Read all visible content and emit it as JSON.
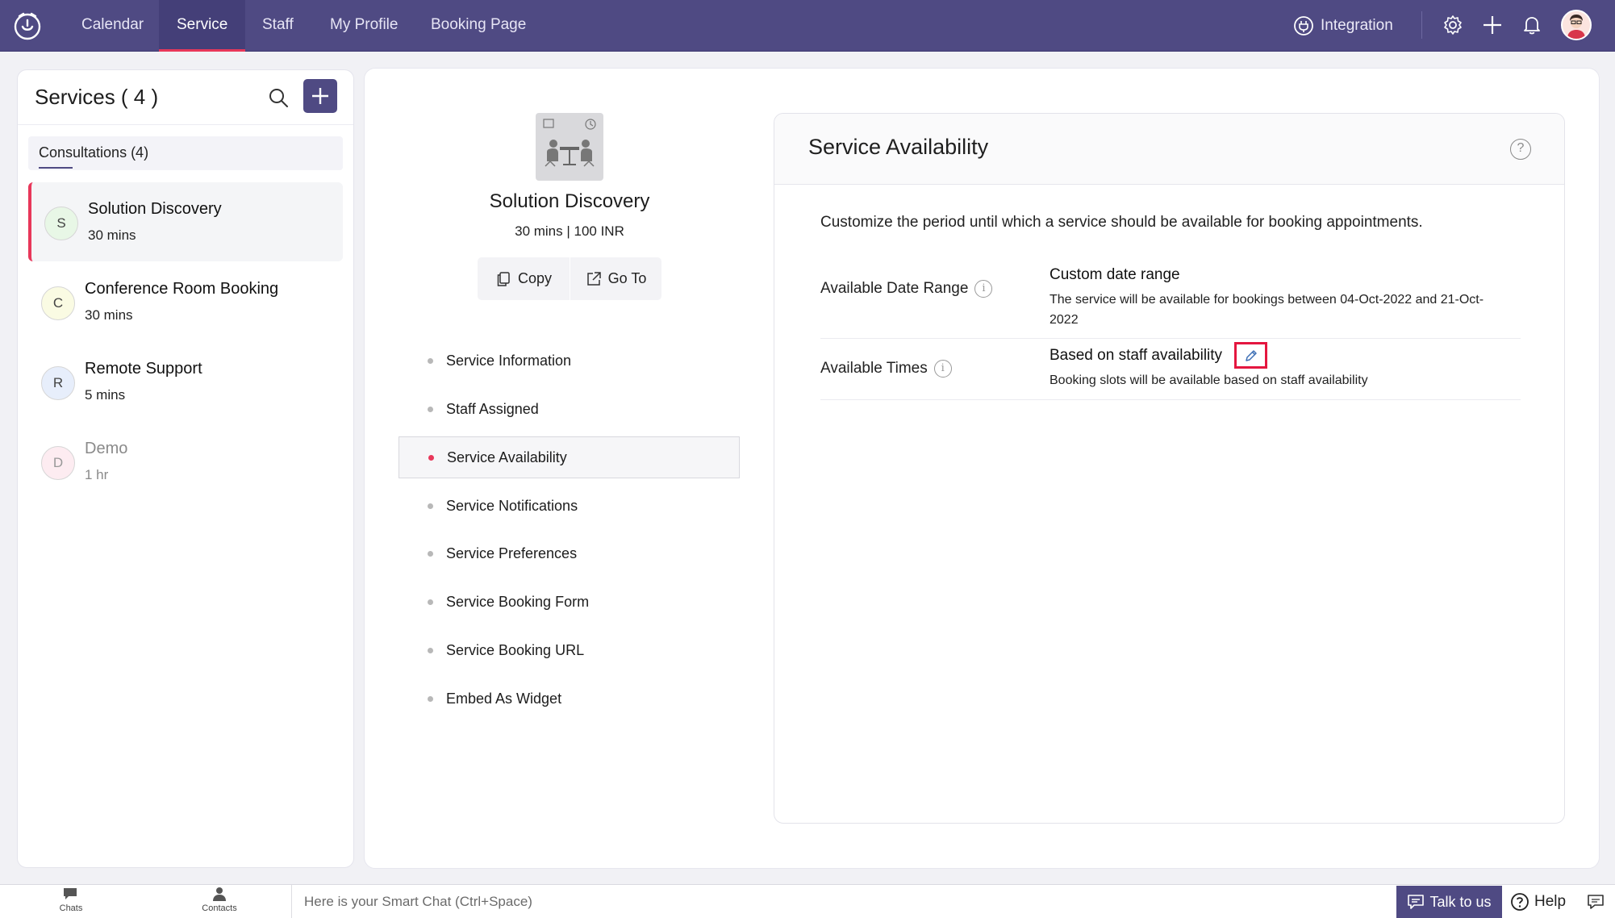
{
  "nav": {
    "tabs": [
      {
        "label": "Calendar"
      },
      {
        "label": "Service"
      },
      {
        "label": "Staff"
      },
      {
        "label": "My Profile"
      },
      {
        "label": "Booking Page"
      }
    ],
    "active_tab": "Service",
    "integration_label": "Integration"
  },
  "services_panel": {
    "title": "Services ( 4 )",
    "category_tab": "Consultations (4)",
    "items": [
      {
        "initial": "S",
        "name": "Solution Discovery",
        "duration": "30 mins",
        "selected": true,
        "color": "#e8f7e6"
      },
      {
        "initial": "C",
        "name": "Conference Room Booking",
        "duration": "30 mins",
        "selected": false,
        "color": "#fafbe3"
      },
      {
        "initial": "R",
        "name": "Remote Support",
        "duration": "5 mins",
        "selected": false,
        "color": "#e7eefb"
      },
      {
        "initial": "D",
        "name": "Demo",
        "duration": "1 hr",
        "selected": false,
        "color": "#fdecf1"
      }
    ]
  },
  "service_detail": {
    "name": "Solution Discovery",
    "subtitle": "30 mins | 100 INR",
    "copy_label": "Copy",
    "goto_label": "Go To",
    "menu": [
      {
        "label": "Service Information"
      },
      {
        "label": "Staff Assigned"
      },
      {
        "label": "Service Availability"
      },
      {
        "label": "Service Notifications"
      },
      {
        "label": "Service Preferences"
      },
      {
        "label": "Service Booking Form"
      },
      {
        "label": "Service Booking URL"
      },
      {
        "label": "Embed As Widget"
      }
    ],
    "active_menu": "Service Availability"
  },
  "availability": {
    "title": "Service Availability",
    "description": "Customize the period until which a service should be available for booking appointments.",
    "date_range": {
      "label": "Available Date Range",
      "value": "Custom date range",
      "desc_prefix": "The service will be available for bookings between ",
      "start": "04-Oct-2022",
      "mid": " and ",
      "end": "21-Oct-2022"
    },
    "times": {
      "label": "Available Times",
      "value": "Based on staff availability",
      "desc": "Booking slots will be available based on staff availability"
    }
  },
  "bottom_bar": {
    "chats": "Chats",
    "contacts": "Contacts",
    "smart_chat_placeholder": "Here is your Smart Chat (Ctrl+Space)",
    "talk_label": "Talk to us",
    "help_label": "Help"
  },
  "colors": {
    "brand": "#4f4a83",
    "accent": "#e8375a"
  }
}
